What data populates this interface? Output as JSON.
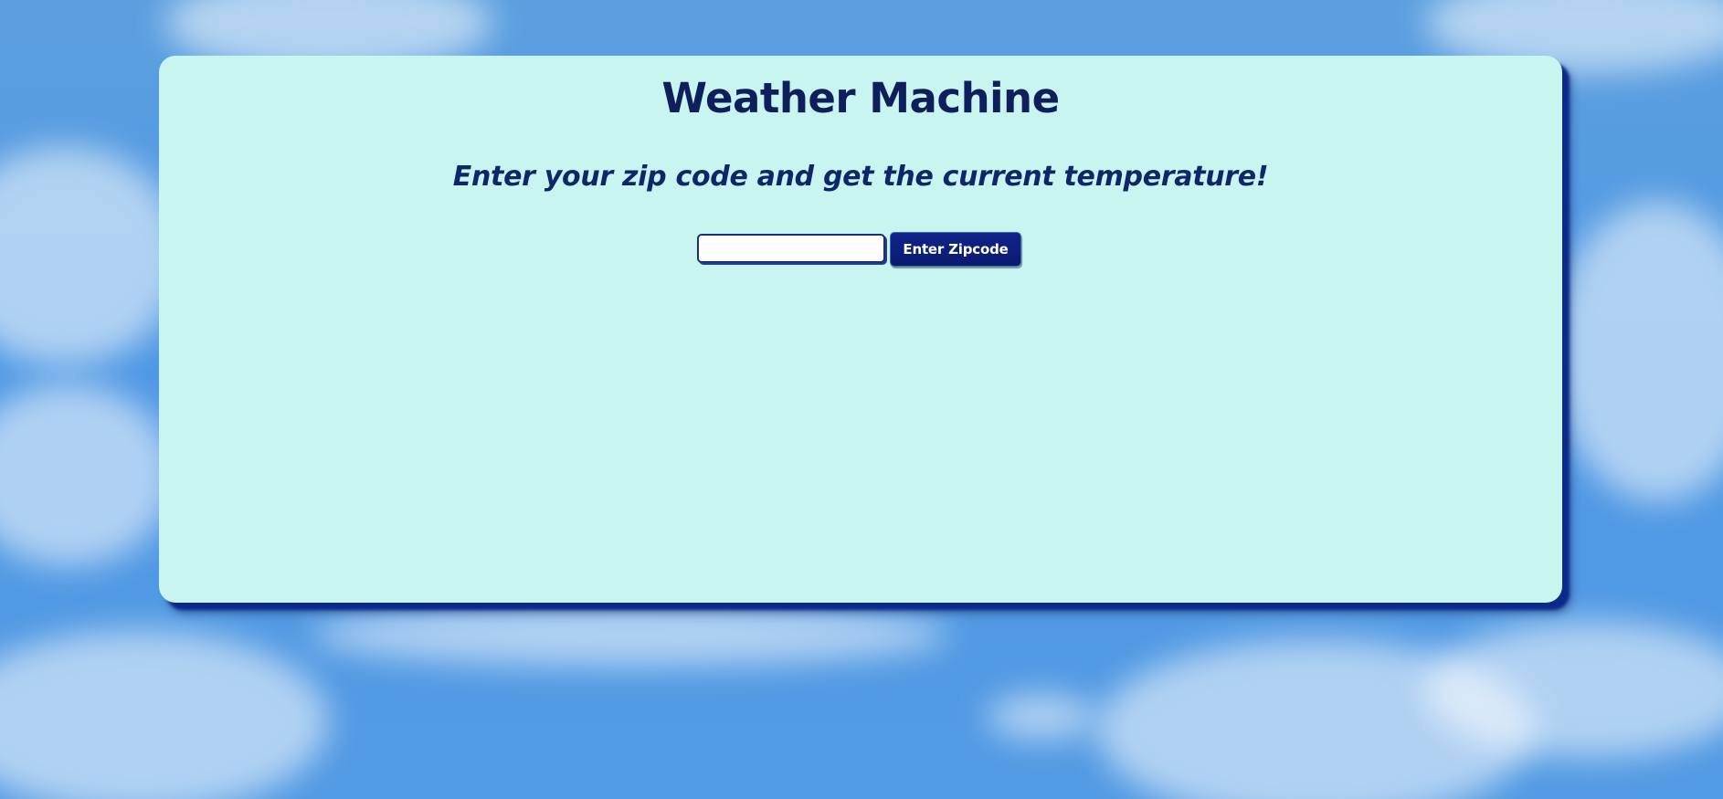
{
  "page": {
    "title": "Weather Machine",
    "subtitle": "Enter your zip code and get the current temperature!"
  },
  "form": {
    "zip_value": "",
    "zip_placeholder": "",
    "button_label": "Enter Zipcode"
  },
  "colors": {
    "card_background": "#c8f5ef",
    "title_text": "#0f1f5c",
    "button_background": "#0a1a6e",
    "card_shadow": "#0b2a8a",
    "sky": "#4f98e4"
  }
}
